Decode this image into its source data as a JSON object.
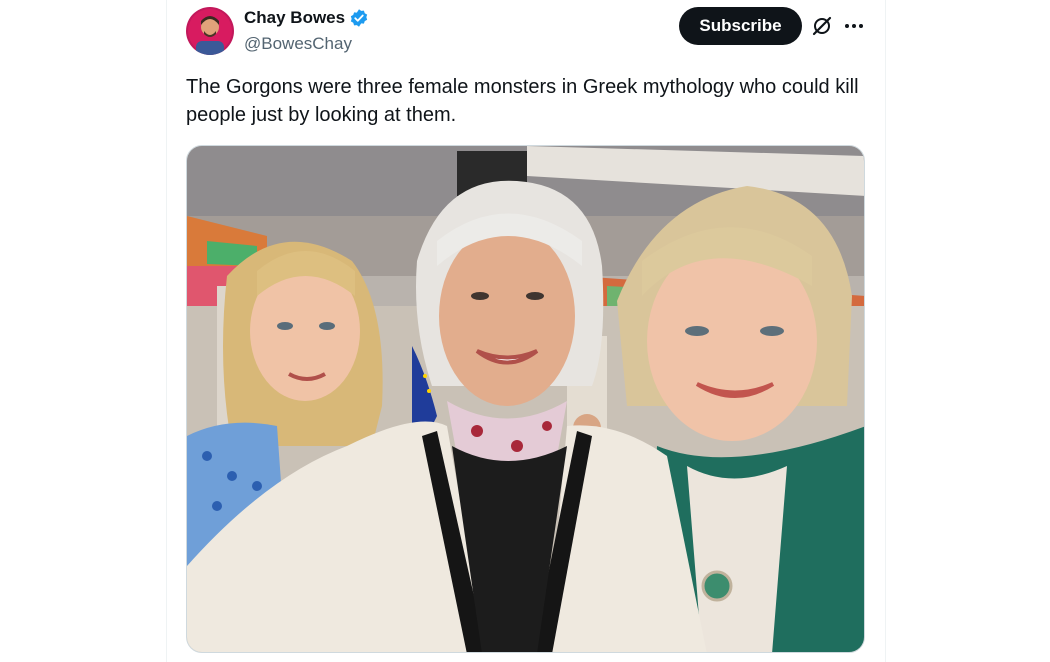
{
  "post": {
    "author": {
      "display_name": "Chay Bowes",
      "handle": "@BowesChay",
      "verified": true,
      "verified_icon": "verified-badge-icon",
      "avatar_icon": "avatar"
    },
    "actions": {
      "subscribe_label": "Subscribe",
      "grok_icon": "grok-icon",
      "more_icon": "more-options-icon"
    },
    "text": "The Gorgons were three female monsters in Greek mythology who could kill people just by looking at them.",
    "media": {
      "kind": "photo",
      "description_icon": "selfie-photo"
    }
  },
  "colors": {
    "text_primary": "#0f1419",
    "text_secondary": "#536471",
    "button_bg": "#0f1419",
    "verified_blue": "#1d9bf0",
    "border": "#cfd9de"
  }
}
